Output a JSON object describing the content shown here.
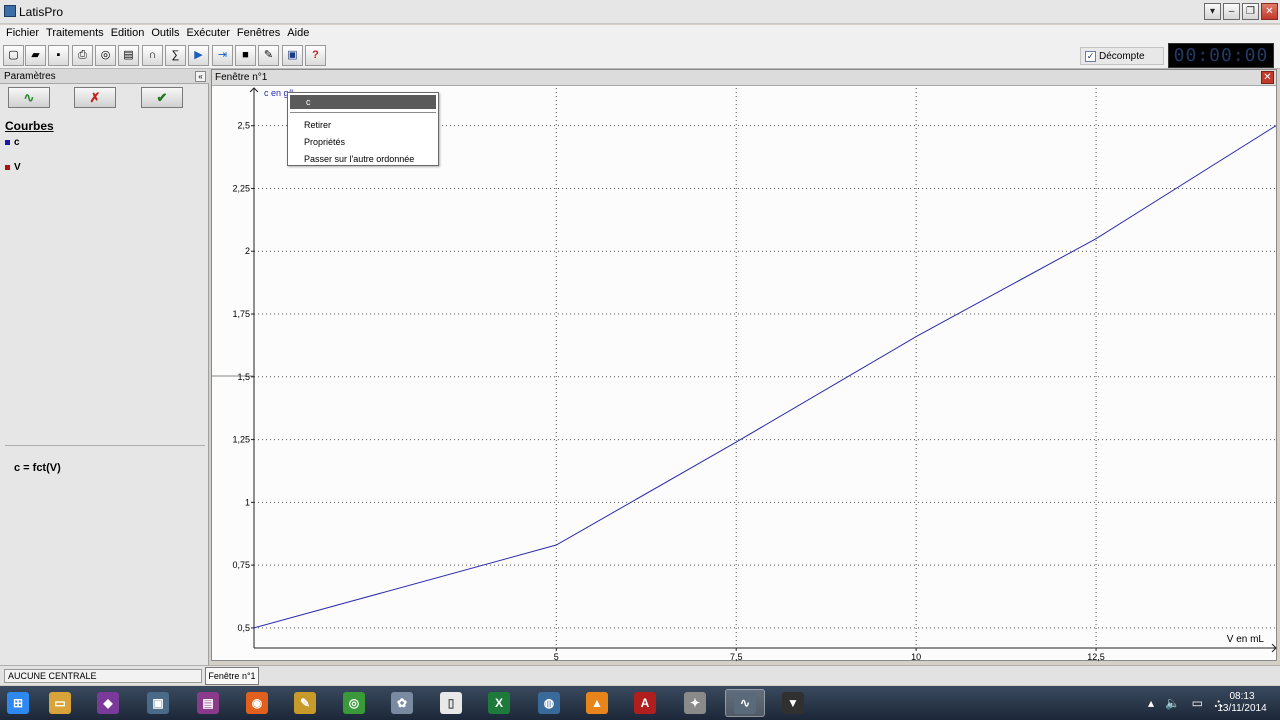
{
  "window": {
    "title": "LatisPro",
    "controls": [
      "▾",
      "–",
      "❐",
      "✕"
    ]
  },
  "menu": [
    "Fichier",
    "Traitements",
    "Edition",
    "Outils",
    "Exécuter",
    "Fenêtres",
    "Aide"
  ],
  "toolbar": {
    "icons": [
      "new-icon",
      "open-icon",
      "save-icon",
      "print-icon",
      "acquisition-icon",
      "window-icon",
      "curve-icon",
      "calculate-icon",
      "play-icon",
      "export-icon",
      "stop-icon",
      "tool-icon",
      "disk-icon",
      "help-icon"
    ],
    "glyphs": [
      "▢",
      "▰",
      "▪",
      "⎙",
      "◎",
      "▤",
      "∩",
      "∑",
      "▶",
      "⇥",
      "■",
      "✎",
      "▣",
      "?"
    ],
    "decompte_label": "Décompte",
    "decompte_checked": true,
    "clock": "00:00:00"
  },
  "left_panel": {
    "header": "Paramètres",
    "collapse_glyph": "«",
    "buttons": [
      {
        "icon": "wave-icon",
        "glyph": "∿"
      },
      {
        "icon": "cancel-check-icon",
        "glyph": "✗"
      },
      {
        "icon": "validate-check-icon",
        "glyph": "✔"
      }
    ],
    "curves_title": "Courbes",
    "curves": [
      {
        "name": "c",
        "color": "#1a1aa6"
      },
      {
        "name": "V",
        "color": "#b01010"
      }
    ],
    "formula": "c = fct(V)"
  },
  "graph_window": {
    "title": "Fenêtre n°1",
    "close_glyph": "✕",
    "y_label": "c en g/L",
    "x_label": "V en mL",
    "context_menu": {
      "title": "c",
      "items": [
        "Retirer",
        "Propriétés",
        "Passer sur l'autre ordonnée"
      ]
    }
  },
  "chart_data": {
    "type": "line",
    "title": "",
    "xlabel": "V en mL",
    "ylabel": "c en g/L",
    "xlim": [
      0.8,
      15
    ],
    "ylim": [
      0.42,
      2.65
    ],
    "x_ticks": [
      5,
      7.5,
      10,
      12.5
    ],
    "x_tick_labels": [
      "5",
      "7,5",
      "10",
      "12,5"
    ],
    "y_ticks": [
      0.5,
      0.75,
      1,
      1.25,
      1.5,
      1.75,
      2,
      2.25,
      2.5
    ],
    "y_tick_labels": [
      "0,5",
      "0,75",
      "1",
      "1,25",
      "1,5",
      "1,75",
      "2",
      "2,25",
      "2,5"
    ],
    "grid": true,
    "series": [
      {
        "color": "#2a2ab0",
        "x": [
          0.8,
          5,
          7.5,
          10,
          12.5,
          15
        ],
        "y": [
          0.5,
          0.83,
          1.24,
          1.66,
          2.05,
          2.5
        ]
      }
    ]
  },
  "status": {
    "centrale": "AUCUNE CENTRALE",
    "tab": "Fenêtre n°1"
  },
  "taskbar": {
    "apps": [
      {
        "icon": "windows-start-icon",
        "color": "#2d89ef",
        "glyph": "⊞"
      },
      {
        "icon": "file-explorer-icon",
        "color": "#d8a43a",
        "glyph": "▭"
      },
      {
        "icon": "paint-app-icon",
        "color": "#7a3a9a",
        "glyph": "◆"
      },
      {
        "icon": "window-app-icon",
        "color": "#4a6a8a",
        "glyph": "▣"
      },
      {
        "icon": "presentation-app-icon",
        "color": "#8a3a8a",
        "glyph": "▤"
      },
      {
        "icon": "firefox-icon",
        "color": "#e2601d",
        "glyph": "◉"
      },
      {
        "icon": "tools-app-icon",
        "color": "#c89a2a",
        "glyph": "✎"
      },
      {
        "icon": "chrome-icon",
        "color": "#3a9a3a",
        "glyph": "◎"
      },
      {
        "icon": "palette-icon",
        "color": "#7a8aa0",
        "glyph": "✿"
      },
      {
        "icon": "document-icon",
        "color": "#e8e8e8",
        "glyph": "▯"
      },
      {
        "icon": "excel-icon",
        "color": "#1e7a3a",
        "glyph": "X"
      },
      {
        "icon": "globe-app-icon",
        "color": "#3a6a9a",
        "glyph": "◍"
      },
      {
        "icon": "vlc-icon",
        "color": "#e8851a",
        "glyph": "▲"
      },
      {
        "icon": "acrobat-icon",
        "color": "#b01e1e",
        "glyph": "A"
      },
      {
        "icon": "generic-app-icon",
        "color": "#8a8a8a",
        "glyph": "✦"
      },
      {
        "icon": "latispro-icon",
        "color": "#5a6a7a",
        "glyph": "∿"
      },
      {
        "icon": "media-app-icon",
        "color": "#303030",
        "glyph": "▼"
      }
    ],
    "tray": [
      "▴",
      "🔈",
      "▭",
      "⛬"
    ],
    "clock_time": "08:13",
    "clock_date": "13/11/2014"
  }
}
